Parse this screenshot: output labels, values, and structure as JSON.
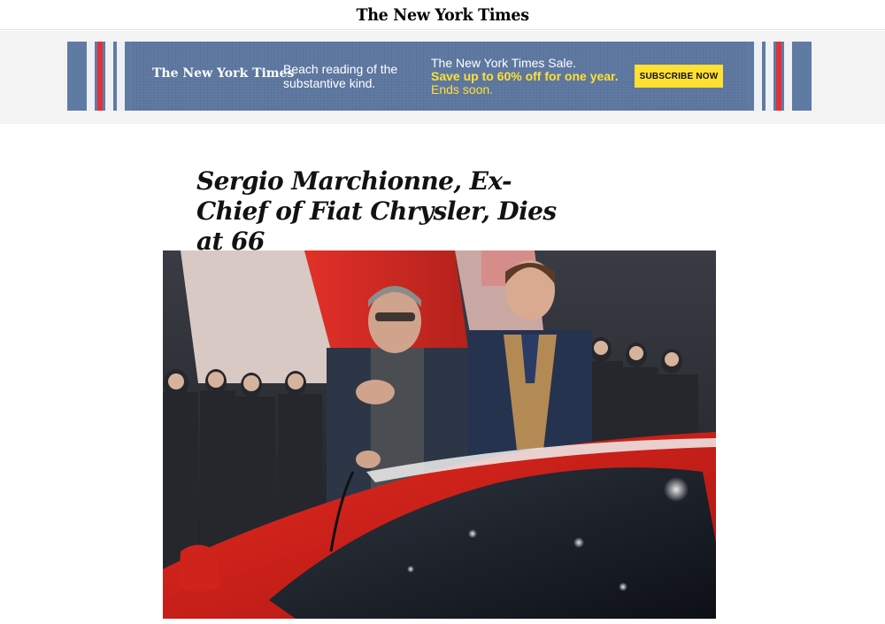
{
  "masthead": {
    "logo": "The New York Times"
  },
  "ad": {
    "logo": "The New York Times",
    "tagline": "Beach reading of the substantive kind.",
    "sale_title": "The New York Times Sale.",
    "sale_offer": "Save up to 60% off for one year.",
    "sale_deadline": "Ends soon.",
    "cta": "SUBSCRIBE NOW",
    "colors": {
      "background": "#5d77a0",
      "accent": "#ffe033",
      "stripe_red": "#e0313a"
    }
  },
  "article": {
    "headline": "Sergio Marchionne, Ex-Chief of Fiat Chrysler, Dies at 66"
  }
}
